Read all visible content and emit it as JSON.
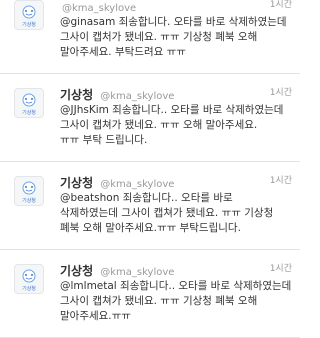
{
  "tweets": [
    {
      "name": "",
      "handle": "@kma_skylove",
      "time": "1시간",
      "lines": [
        "@ginasam 죄송합니다. 오타를 바로 삭제하였는데",
        "그사이 캡처가 됐네요. ㅠㅠ 기상청 폐북 오해",
        "말아주세요. 부탁드려요 ㅠㅠ"
      ]
    },
    {
      "name": "기상청",
      "handle": "@kma_skylove",
      "time": "1시간",
      "lines": [
        "@JJhsKim 죄송합니다.. 오타를 바로 삭제하였는데",
        "그사이 캡쳐가 됐네요. ㅠㅠ 오해 말아주세요.",
        "ㅠㅠ 부탁 드립니다."
      ]
    },
    {
      "name": "기상청",
      "handle": "@kma_skylove",
      "time": "1시간",
      "lines": [
        "@beatshon 죄송합니다.. 오타를 바로",
        "삭제하였는데 그사이 캡쳐가 됐네요. ㅠㅠ 기상청",
        "폐북 오해 말아주세요.ㅠㅠ 부탁드립니다."
      ]
    },
    {
      "name": "기상청",
      "handle": "@kma_skylove",
      "time": "1시간",
      "lines": [
        "@lmlmetal 죄송합니다.. 오타를 바로 삭제하였는데",
        "그사이 캡쳐가 됐네요. ㅠㅠ 기상청 폐북 오해",
        "말아주세요.ㅠㅠ"
      ]
    }
  ],
  "avatar_label": "기상청",
  "colors": {
    "accent": "#3a7bd5",
    "text": "#333333",
    "muted": "#999999",
    "divider": "#e3e3e3"
  }
}
